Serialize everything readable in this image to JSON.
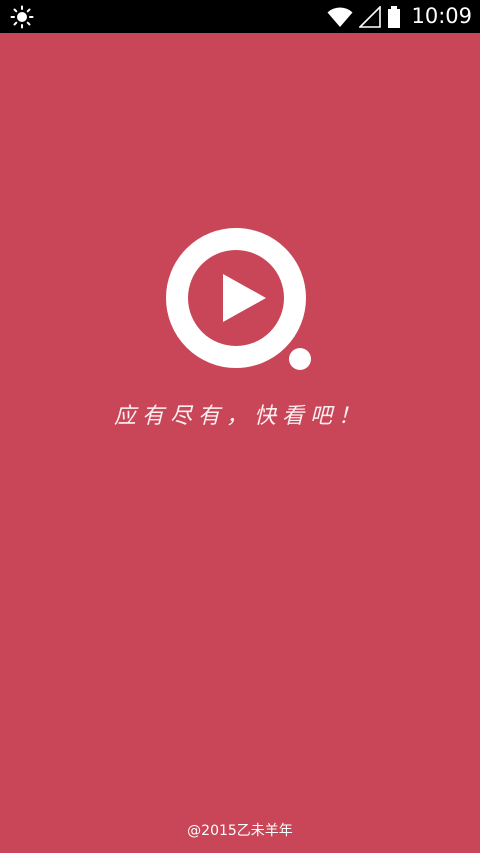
{
  "status_bar": {
    "time": "10:09",
    "left_icon": "brightness-icon",
    "wifi_icon": "wifi-icon",
    "signal_icon": "signal-icon",
    "battery_icon": "battery-icon"
  },
  "splash": {
    "slogan": "应有尽有，快看吧！",
    "footer": "@2015乙未羊年"
  },
  "colors": {
    "background": "#c94658",
    "status_bar": "#000000",
    "logo": "#ffffff"
  }
}
